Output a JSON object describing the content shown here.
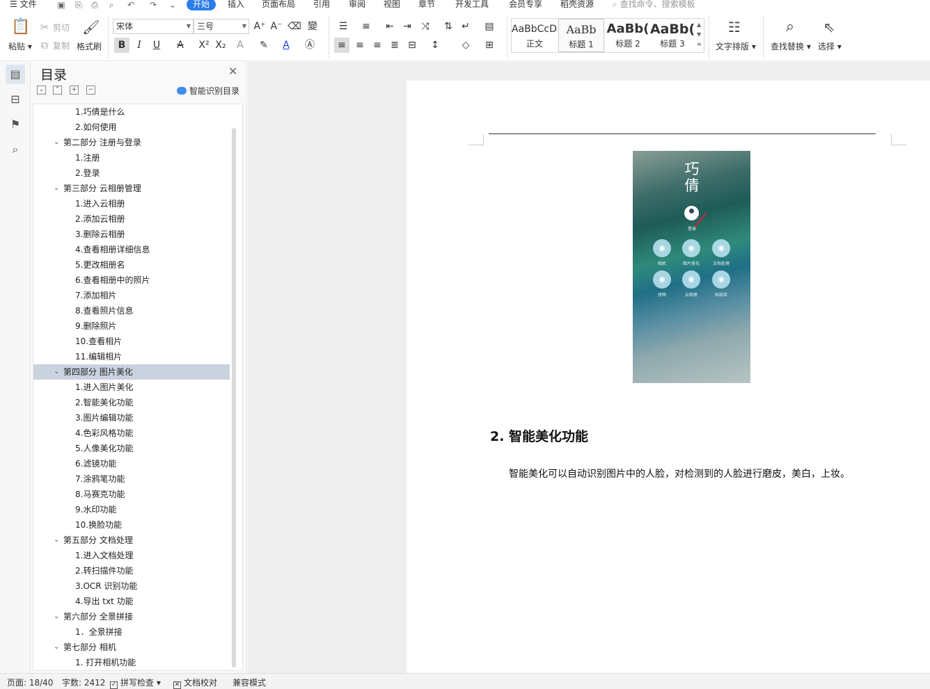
{
  "menu": {
    "file": "文件",
    "tabs": [
      "开始",
      "插入",
      "页面布局",
      "引用",
      "审阅",
      "视图",
      "章节",
      "开发工具",
      "会员专享",
      "稻壳资源"
    ],
    "search_placeholder": "查找命令、搜索模板"
  },
  "ribbon": {
    "paste": "粘贴",
    "cut": "剪切",
    "copy": "复制",
    "format_painter": "格式刷",
    "font_name": "宋体",
    "font_size": "三号",
    "styles": [
      {
        "sample": "AaBbCcDd",
        "label": "正文"
      },
      {
        "sample": "AaBb",
        "label": "标题 1"
      },
      {
        "sample": "AaBb(",
        "label": "标题 2"
      },
      {
        "sample": "AaBb(",
        "label": "标题 3"
      }
    ],
    "text_layout": "文字排版",
    "find_replace": "查找替换",
    "select": "选择"
  },
  "toc": {
    "title": "目录",
    "smart_label": "智能识别目录",
    "items": [
      {
        "text": "1.巧倩是什么",
        "level": 2
      },
      {
        "text": "2.如何使用",
        "level": 2
      },
      {
        "text": "第二部分 注册与登录",
        "level": 1
      },
      {
        "text": "1.注册",
        "level": 2
      },
      {
        "text": "2.登录",
        "level": 2
      },
      {
        "text": "第三部分 云相册管理",
        "level": 1
      },
      {
        "text": "1.进入云相册",
        "level": 2
      },
      {
        "text": "2.添加云相册",
        "level": 2
      },
      {
        "text": "3.删除云相册",
        "level": 2
      },
      {
        "text": "4.查看相册详细信息",
        "level": 2
      },
      {
        "text": "5.更改相册名",
        "level": 2
      },
      {
        "text": "6.查看相册中的照片",
        "level": 2
      },
      {
        "text": "7.添加相片",
        "level": 2
      },
      {
        "text": "8.查看照片信息",
        "level": 2
      },
      {
        "text": "9.删除照片",
        "level": 2
      },
      {
        "text": "10.查看相片",
        "level": 2
      },
      {
        "text": "11.编辑相片",
        "level": 2
      },
      {
        "text": "第四部分 图片美化",
        "level": 1,
        "selected": true
      },
      {
        "text": "1.进入图片美化",
        "level": 2
      },
      {
        "text": "2.智能美化功能",
        "level": 2
      },
      {
        "text": "3.图片编辑功能",
        "level": 2
      },
      {
        "text": "4.色彩风格功能",
        "level": 2
      },
      {
        "text": "5.人像美化功能",
        "level": 2
      },
      {
        "text": "6.滤镜功能",
        "level": 2
      },
      {
        "text": "7.涂鸦笔功能",
        "level": 2
      },
      {
        "text": "8.马赛克功能",
        "level": 2
      },
      {
        "text": "9.水印功能",
        "level": 2
      },
      {
        "text": "10.换脸功能",
        "level": 2
      },
      {
        "text": "第五部分 文档处理",
        "level": 1
      },
      {
        "text": "1.进入文档处理",
        "level": 2
      },
      {
        "text": "2.转扫描件功能",
        "level": 2
      },
      {
        "text": "3.OCR 识别功能",
        "level": 2
      },
      {
        "text": "4.导出 txt 功能",
        "level": 2
      },
      {
        "text": "第六部分 全景拼接",
        "level": 1
      },
      {
        "text": "1．全景拼接",
        "level": 2
      },
      {
        "text": "第七部分 相机",
        "level": 1
      },
      {
        "text": "1. 打开相机功能",
        "level": 2
      }
    ]
  },
  "document": {
    "image": {
      "logo_text": "巧倩",
      "login_label": "登录",
      "buttons": [
        "相机",
        "图片美化",
        "文档处理",
        "拼图",
        "云相册",
        "贴纸库"
      ]
    },
    "heading": "2.  智能美化功能",
    "paragraph": "智能美化可以自动识别图片中的人脸，对检测到的人脸进行磨皮，美白，上妆。"
  },
  "status": {
    "page": "页面: 18/40",
    "words": "字数: 2412",
    "spell_check": "拼写检查",
    "doc_check": "文档校对",
    "compat_mode": "兼容模式"
  },
  "colors": {
    "accent": "#2b7de9",
    "toc_selected": "#c9d3df"
  }
}
